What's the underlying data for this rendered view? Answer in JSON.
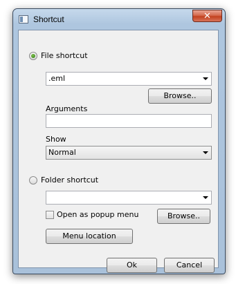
{
  "window": {
    "title": "Shortcut",
    "close_label": "✕"
  },
  "file_shortcut": {
    "label": "File shortcut",
    "selected": true,
    "file_value": ".eml",
    "browse_label": "Browse..",
    "arguments_label": "Arguments",
    "arguments_value": "",
    "show_label": "Show",
    "show_value": "Normal"
  },
  "folder_shortcut": {
    "label": "Folder shortcut",
    "selected": false,
    "folder_value": "",
    "popup_label": "Open as popup menu",
    "popup_checked": false,
    "browse_label": "Browse..",
    "menu_location_label": "Menu location"
  },
  "actions": {
    "ok_label": "Ok",
    "cancel_label": "Cancel"
  }
}
